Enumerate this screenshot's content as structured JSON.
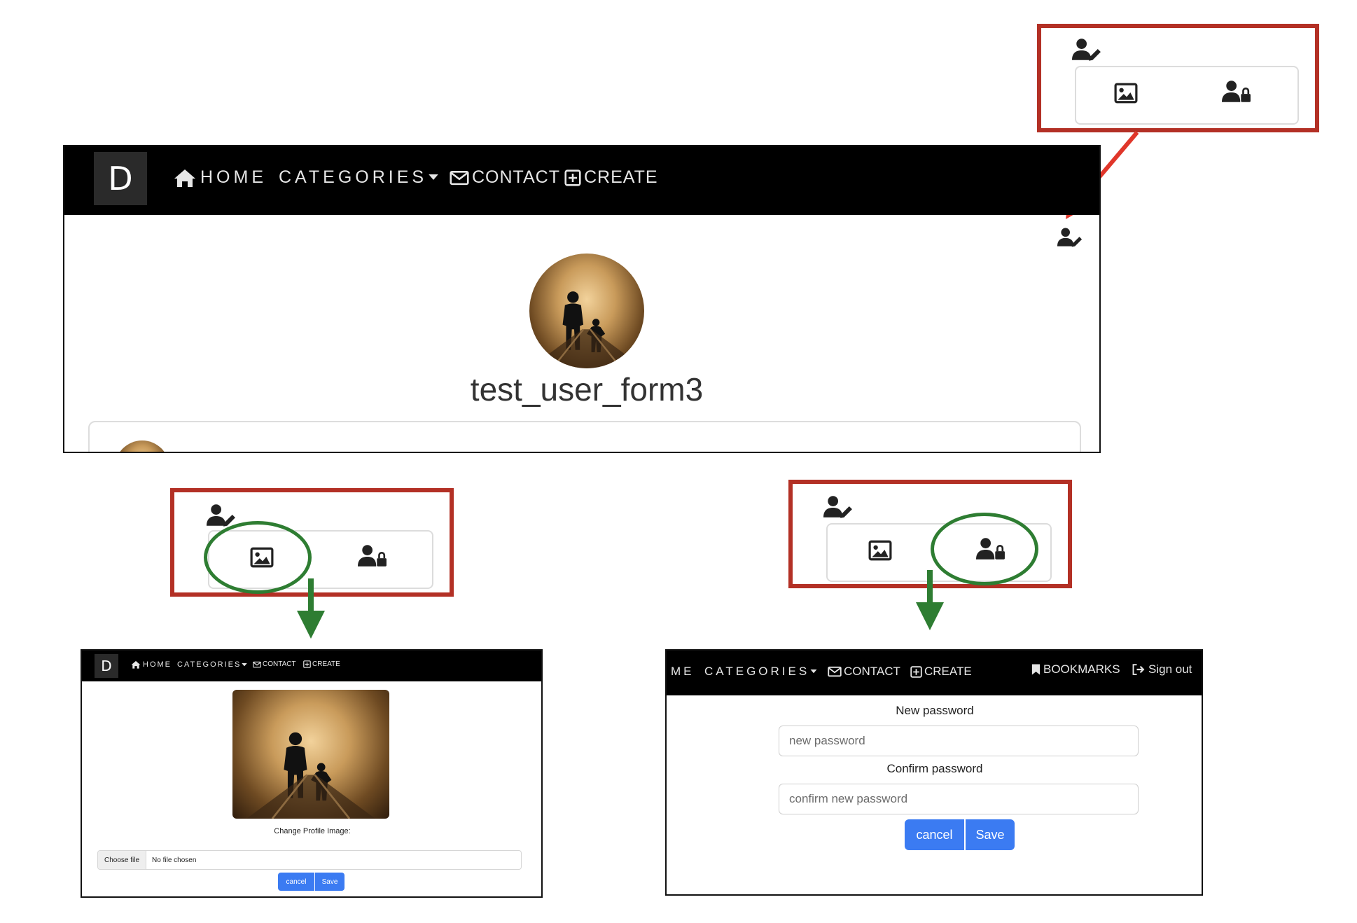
{
  "navbar": {
    "logo": "D",
    "home": "HOME",
    "categories": "CATEGORIES",
    "contact": "CONTACT",
    "create": "CREATE",
    "bookmarks": "BOOKMARKS",
    "sign_out": "Sign out",
    "home_cropped": "ME"
  },
  "profile": {
    "username": "test_user_form3"
  },
  "image_form": {
    "change_label": "Change Profile Image:",
    "choose_file": "Choose file",
    "no_file": "No file chosen",
    "cancel": "cancel",
    "save": "Save"
  },
  "password_form": {
    "new_label": "New password",
    "new_placeholder": "new password",
    "confirm_label": "Confirm password",
    "confirm_placeholder": "confirm new password",
    "cancel": "cancel",
    "save": "Save"
  },
  "icons": [
    "user-edit-icon",
    "image-icon",
    "user-lock-icon",
    "home-icon",
    "envelope-icon",
    "plus-square-icon",
    "bookmark-icon",
    "sign-out-icon",
    "caret-down-icon"
  ],
  "colors": {
    "callout_red": "#b33025",
    "highlight_green": "#2e7d32",
    "button_blue": "#3b7bf2",
    "navbar": "#000000"
  }
}
